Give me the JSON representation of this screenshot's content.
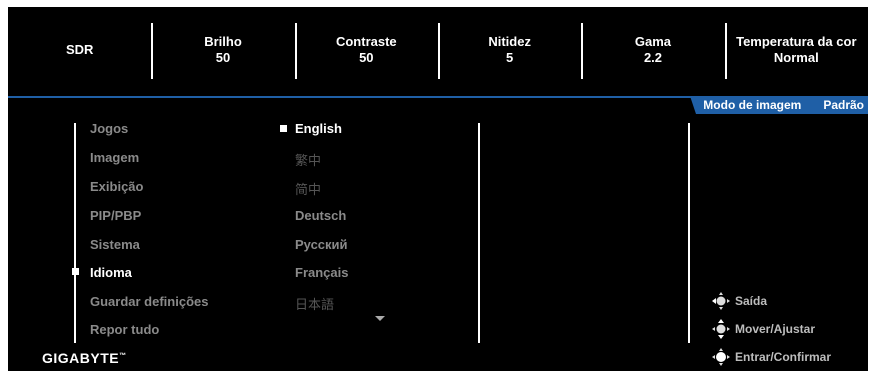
{
  "header": {
    "cells": [
      {
        "label": "SDR",
        "value": ""
      },
      {
        "label": "Brilho",
        "value": "50"
      },
      {
        "label": "Contraste",
        "value": "50"
      },
      {
        "label": "Nitidez",
        "value": "5"
      },
      {
        "label": "Gama",
        "value": "2.2"
      },
      {
        "label": "Temperatura da cor",
        "value": "Normal"
      }
    ]
  },
  "status_tab": {
    "label": "Modo de imagem",
    "value": "Padrão"
  },
  "menu": {
    "items": [
      "Jogos",
      "Imagem",
      "Exibição",
      "PIP/PBP",
      "Sistema",
      "Idioma",
      "Guardar definições",
      "Repor tudo"
    ],
    "active": "Idioma"
  },
  "languages": {
    "items": [
      "English",
      "繁中",
      "简中",
      "Deutsch",
      "Русский",
      "Français",
      "日本語"
    ],
    "selected": "English"
  },
  "hints": {
    "exit": "Saída",
    "move_adjust": "Mover/Ajustar",
    "enter_confirm": "Entrar/Confirmar"
  },
  "brand": {
    "logo": "GIGABYTE",
    "tm": "™"
  },
  "colors": {
    "accent": "#1f5fa6",
    "background": "#000000"
  }
}
